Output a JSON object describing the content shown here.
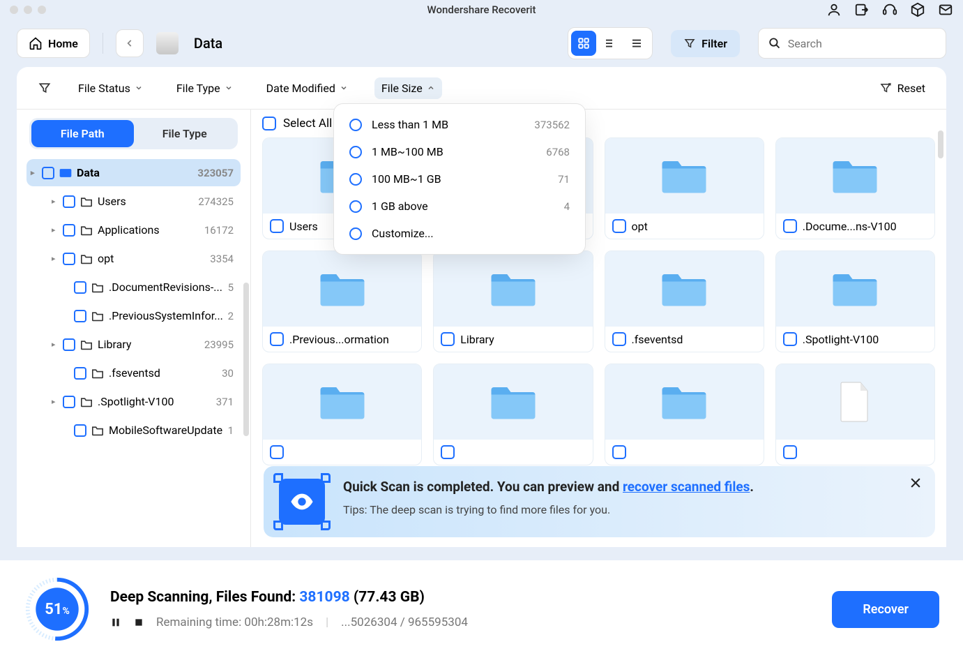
{
  "app_title": "Wondershare Recoverit",
  "toolbar": {
    "home_label": "Home",
    "breadcrumb": "Data",
    "filter_label": "Filter",
    "search_placeholder": "Search"
  },
  "filterbar": {
    "file_status": "File Status",
    "file_type": "File Type",
    "date_modified": "Date Modified",
    "file_size": "File Size",
    "reset": "Reset"
  },
  "sidebar": {
    "tab_file_path": "File Path",
    "tab_file_type": "File Type",
    "items": [
      {
        "label": "Data",
        "count": "323057",
        "level": 0,
        "caret": true,
        "selected": true,
        "drive": true
      },
      {
        "label": "Users",
        "count": "274325",
        "level": 1,
        "caret": true
      },
      {
        "label": "Applications",
        "count": "16172",
        "level": 1,
        "caret": true
      },
      {
        "label": "opt",
        "count": "3354",
        "level": 1,
        "caret": true
      },
      {
        "label": ".DocumentRevisions-...",
        "count": "5",
        "level": 2,
        "caret": false
      },
      {
        "label": ".PreviousSystemInfor...",
        "count": "2",
        "level": 2,
        "caret": false
      },
      {
        "label": "Library",
        "count": "23995",
        "level": 1,
        "caret": true
      },
      {
        "label": ".fseventsd",
        "count": "30",
        "level": 2,
        "caret": false
      },
      {
        "label": ".Spotlight-V100",
        "count": "371",
        "level": 1,
        "caret": true
      },
      {
        "label": "MobileSoftwareUpdate",
        "count": "1",
        "level": 2,
        "caret": false
      }
    ]
  },
  "select_all": "Select All",
  "grid_items": [
    {
      "label": "Users",
      "type": "folder"
    },
    {
      "label": "",
      "type": "folder"
    },
    {
      "label": "opt",
      "type": "folder"
    },
    {
      "label": ".Docume...ns-V100",
      "type": "folder"
    },
    {
      "label": ".Previous...ormation",
      "type": "folder"
    },
    {
      "label": "Library",
      "type": "folder"
    },
    {
      "label": ".fseventsd",
      "type": "folder"
    },
    {
      "label": ".Spotlight-V100",
      "type": "folder"
    },
    {
      "label": "",
      "type": "folder"
    },
    {
      "label": "",
      "type": "folder"
    },
    {
      "label": "",
      "type": "folder"
    },
    {
      "label": "",
      "type": "file"
    }
  ],
  "popover": {
    "items": [
      {
        "label": "Less than 1 MB",
        "count": "373562"
      },
      {
        "label": "1 MB~100 MB",
        "count": "6768"
      },
      {
        "label": "100 MB~1 GB",
        "count": "71"
      },
      {
        "label": "1 GB above",
        "count": "4"
      },
      {
        "label": "Customize...",
        "count": ""
      }
    ]
  },
  "banner": {
    "title_pre": "Quick Scan is completed. You can preview and ",
    "title_link": "recover scanned files",
    "title_post": ".",
    "tip": "Tips: The deep scan is trying to find more files for you."
  },
  "footer": {
    "progress_pct": "51",
    "progress_suffix": "%",
    "line1_pre": "Deep Scanning, Files Found: ",
    "files_found": "381098",
    "size": "(77.43 GB)",
    "remaining_label": "Remaining time: ",
    "remaining": "00h:28m:12s",
    "counter": "...5026304 / 965595304",
    "recover": "Recover"
  }
}
